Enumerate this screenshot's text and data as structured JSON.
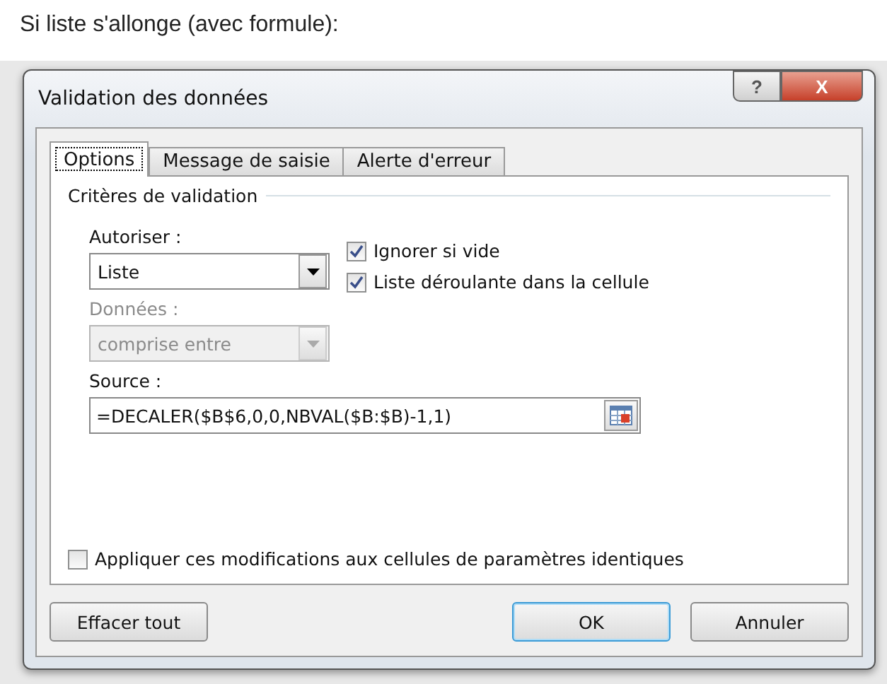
{
  "heading": "Si liste s'allonge (avec formule):",
  "window": {
    "title": "Validation des données",
    "help": "?",
    "close": "X"
  },
  "tabs": [
    {
      "label": "Options",
      "selected": true
    },
    {
      "label": "Message de saisie",
      "selected": false
    },
    {
      "label": "Alerte d'erreur",
      "selected": false
    }
  ],
  "group": {
    "title": "Critères de validation"
  },
  "allow": {
    "label": "Autoriser :",
    "value": "Liste",
    "disabled": false
  },
  "data": {
    "label": "Données :",
    "value": "comprise entre",
    "disabled": true
  },
  "checks": [
    {
      "label": "Ignorer si vide",
      "checked": true
    },
    {
      "label": "Liste déroulante dans la cellule",
      "checked": true
    }
  ],
  "source": {
    "label": "Source :",
    "value": "=DECALER($B$6,0,0,NBVAL($B:$B)-1,1)"
  },
  "apply": {
    "label": "Appliquer ces modifications aux cellules de paramètres identiques",
    "checked": false
  },
  "buttons": [
    {
      "label": "Effacer tout",
      "kind": "left",
      "selected": false
    },
    {
      "label": "OK",
      "kind": "right",
      "selected": true
    },
    {
      "label": "Annuler",
      "kind": "right",
      "selected": false
    }
  ]
}
